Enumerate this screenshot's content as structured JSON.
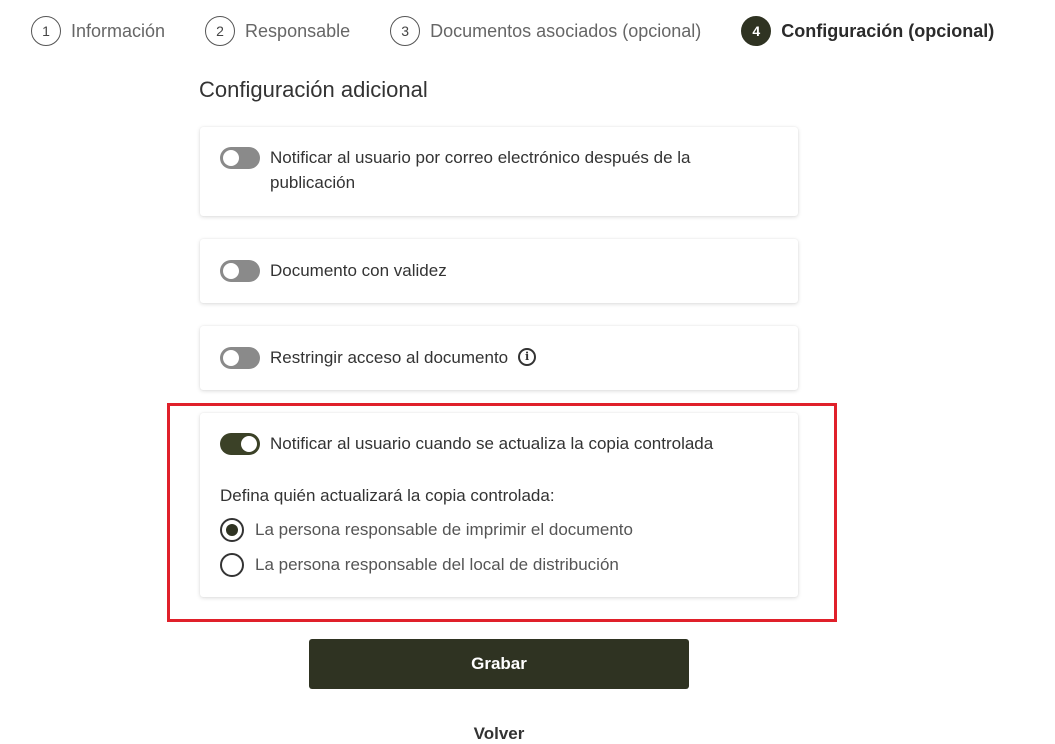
{
  "stepper": {
    "steps": [
      {
        "number": "1",
        "label": "Información"
      },
      {
        "number": "2",
        "label": "Responsable"
      },
      {
        "number": "3",
        "label": "Documentos asociados (opcional)"
      },
      {
        "number": "4",
        "label": "Configuración (opcional)"
      }
    ],
    "active_step": "4"
  },
  "section": {
    "title": "Configuración adicional"
  },
  "settings": [
    {
      "label": "Notificar al usuario por correo electrónico después de la publicación",
      "enabled": false
    },
    {
      "label": "Documento con validez",
      "enabled": false
    },
    {
      "label": "Restringir acceso al documento",
      "enabled": false,
      "info_icon": "info-circle-icon",
      "info_glyph": "i"
    },
    {
      "label": "Notificar al usuario cuando se actualiza la copia controlada",
      "enabled": true
    }
  ],
  "controlled_copy": {
    "prompt": "Defina quién actualizará la copia controlada:",
    "options": [
      {
        "label": "La persona responsable de imprimir el documento",
        "selected": true
      },
      {
        "label": "La persona responsable del local de distribución",
        "selected": false
      }
    ]
  },
  "actions": {
    "save_label": "Grabar",
    "back_label": "Volver"
  },
  "colors": {
    "primary": "#2f3322",
    "highlight": "#e0202a",
    "toggle_off": "#8a8a8a"
  }
}
